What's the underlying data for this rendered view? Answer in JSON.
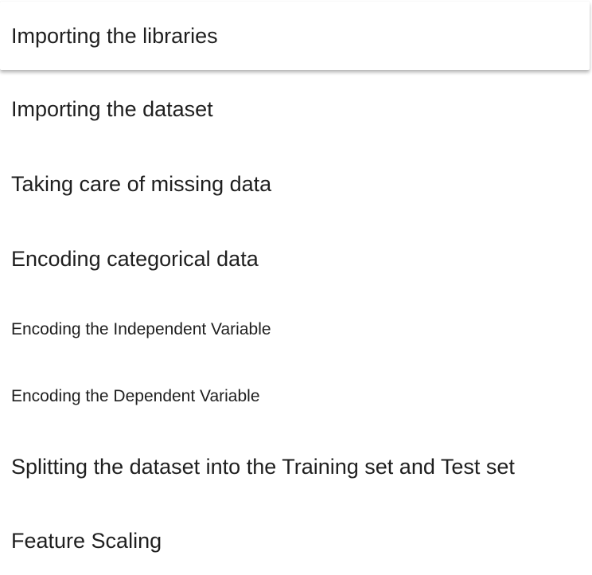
{
  "toc": {
    "items": [
      {
        "label": "Importing the libraries",
        "level": "section",
        "selected": true
      },
      {
        "label": "Importing the dataset",
        "level": "section",
        "selected": false
      },
      {
        "label": "Taking care of missing data",
        "level": "section",
        "selected": false
      },
      {
        "label": "Encoding categorical data",
        "level": "section",
        "selected": false
      },
      {
        "label": "Encoding the Independent Variable",
        "level": "subsection",
        "selected": false
      },
      {
        "label": "Encoding the Dependent Variable",
        "level": "subsection",
        "selected": false
      },
      {
        "label": "Splitting the dataset into the Training set and Test set",
        "level": "section",
        "selected": false
      },
      {
        "label": "Feature Scaling",
        "level": "section",
        "selected": false
      }
    ]
  },
  "colors": {
    "text": "#1f1f1f",
    "background": "#ffffff",
    "selected_shadow": "#9e9e9e"
  }
}
